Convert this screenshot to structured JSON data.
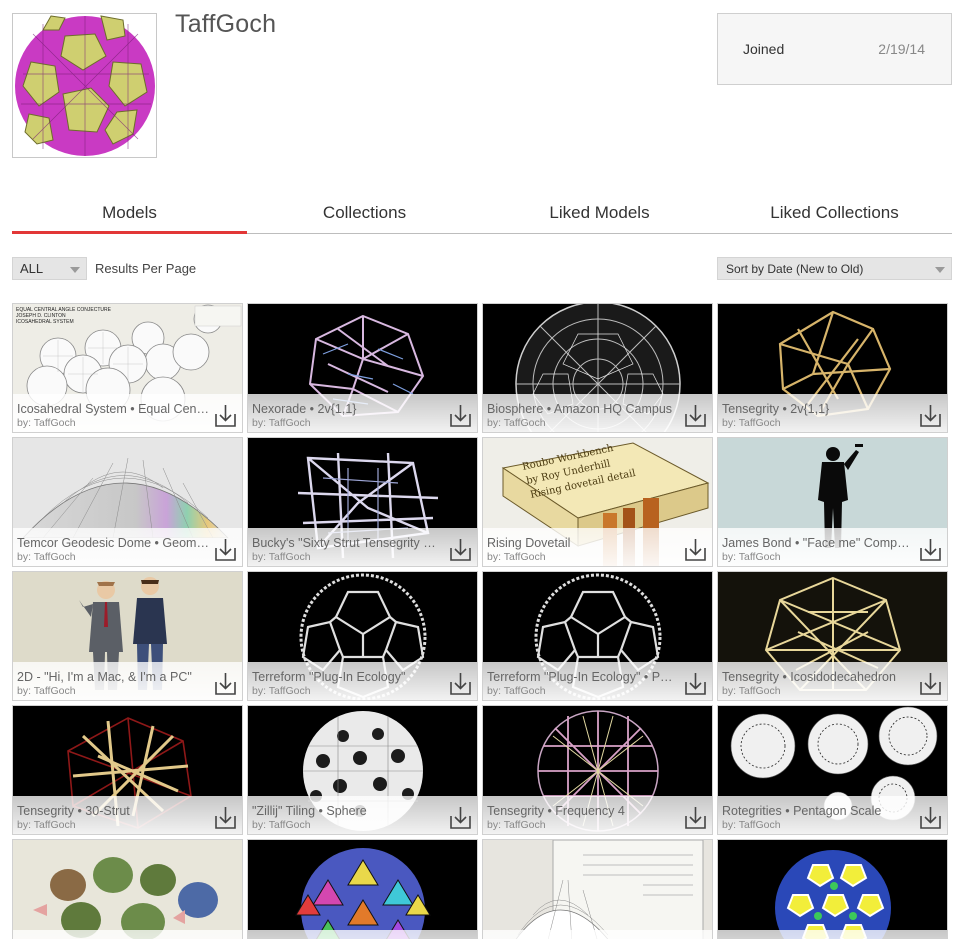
{
  "profile": {
    "username": "TaffGoch",
    "joined_label": "Joined",
    "joined_date": "2/19/14"
  },
  "tabs": [
    {
      "label": "Models",
      "active": true
    },
    {
      "label": "Collections",
      "active": false
    },
    {
      "label": "Liked Models",
      "active": false
    },
    {
      "label": "Liked Collections",
      "active": false
    }
  ],
  "filter": {
    "value": "ALL",
    "results_label": "Results Per Page"
  },
  "sort": {
    "value": "Sort by Date (New to Old)"
  },
  "models": [
    {
      "title": "Icosahedral System • Equal Central Angle Conjecture",
      "author": "by: TaffGoch"
    },
    {
      "title": "Nexorade • 2v{1,1}",
      "author": "by: TaffGoch"
    },
    {
      "title": "Biosphere • Amazon HQ Campus",
      "author": "by: TaffGoch"
    },
    {
      "title": "Tensegrity • 2v{1,1}",
      "author": "by: TaffGoch"
    },
    {
      "title": "Temcor Geodesic Dome • Geometry",
      "author": "by: TaffGoch"
    },
    {
      "title": "Bucky's \"Sixty Strut Tensegrity Sphere\"",
      "author": "by: TaffGoch"
    },
    {
      "title": "Rising Dovetail",
      "author": "by: TaffGoch"
    },
    {
      "title": "James Bond • \"Face me\" Composition",
      "author": "by: TaffGoch"
    },
    {
      "title": "2D - \"Hi, I'm a Mac, & I'm a PC\"",
      "author": "by: TaffGoch"
    },
    {
      "title": "Terreform \"Plug-In Ecology\"",
      "author": "by: TaffGoch"
    },
    {
      "title": "Terreform \"Plug-In Ecology\" • Pentagon",
      "author": "by: TaffGoch"
    },
    {
      "title": "Tensegrity • Icosidodecahedron",
      "author": "by: TaffGoch"
    },
    {
      "title": "Tensegrity • 30-Strut",
      "author": "by: TaffGoch"
    },
    {
      "title": "\"Zillij\" Tiling • Sphere",
      "author": "by: TaffGoch"
    },
    {
      "title": "Tensegrity • Frequency 4",
      "author": "by: TaffGoch"
    },
    {
      "title": "Rotegrities • Pentagon Scale",
      "author": "by: TaffGoch"
    },
    {
      "title": "",
      "author": ""
    },
    {
      "title": "",
      "author": ""
    },
    {
      "title": "",
      "author": ""
    },
    {
      "title": "",
      "author": ""
    }
  ],
  "colors": {
    "accent": "#e23737",
    "tab_border": "#bdbdbd",
    "dropdown_bg": "#e5e5e5"
  },
  "icons": {
    "download": "download-icon",
    "caret": "chevron-down-icon"
  }
}
